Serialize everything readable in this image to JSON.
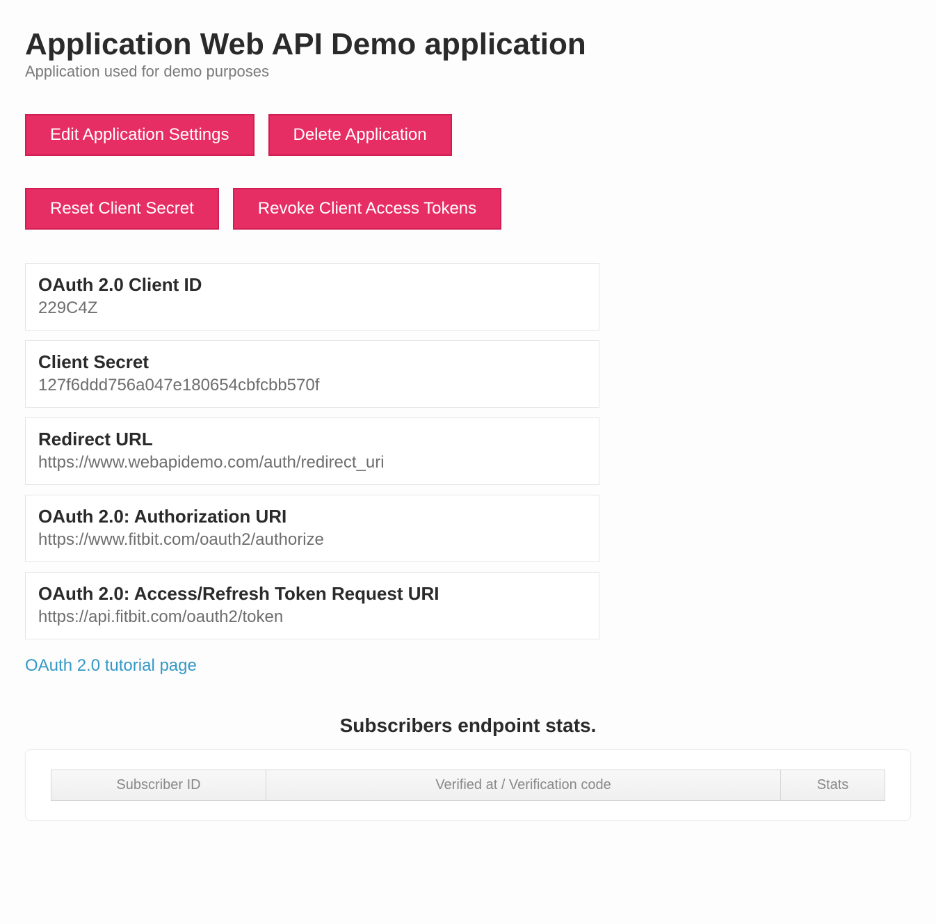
{
  "header": {
    "title": "Application Web API Demo application",
    "subtitle": "Application used for demo purposes"
  },
  "buttons": {
    "edit": "Edit Application Settings",
    "delete": "Delete Application",
    "reset_secret": "Reset Client Secret",
    "revoke_tokens": "Revoke Client Access Tokens"
  },
  "info": [
    {
      "label": "OAuth 2.0 Client ID",
      "value": "229C4Z"
    },
    {
      "label": "Client Secret",
      "value": "127f6ddd756a047e180654cbfcbb570f"
    },
    {
      "label": "Redirect URL",
      "value": "https://www.webapidemo.com/auth/redirect_uri"
    },
    {
      "label": "OAuth 2.0: Authorization URI",
      "value": "https://www.fitbit.com/oauth2/authorize"
    },
    {
      "label": "OAuth 2.0: Access/Refresh Token Request URI",
      "value": "https://api.fitbit.com/oauth2/token"
    }
  ],
  "tutorial_link": "OAuth 2.0 tutorial page",
  "stats": {
    "heading": "Subscribers endpoint stats.",
    "columns": {
      "subscriber": "Subscriber ID",
      "verified": "Verified at / Verification code",
      "stats": "Stats"
    }
  }
}
